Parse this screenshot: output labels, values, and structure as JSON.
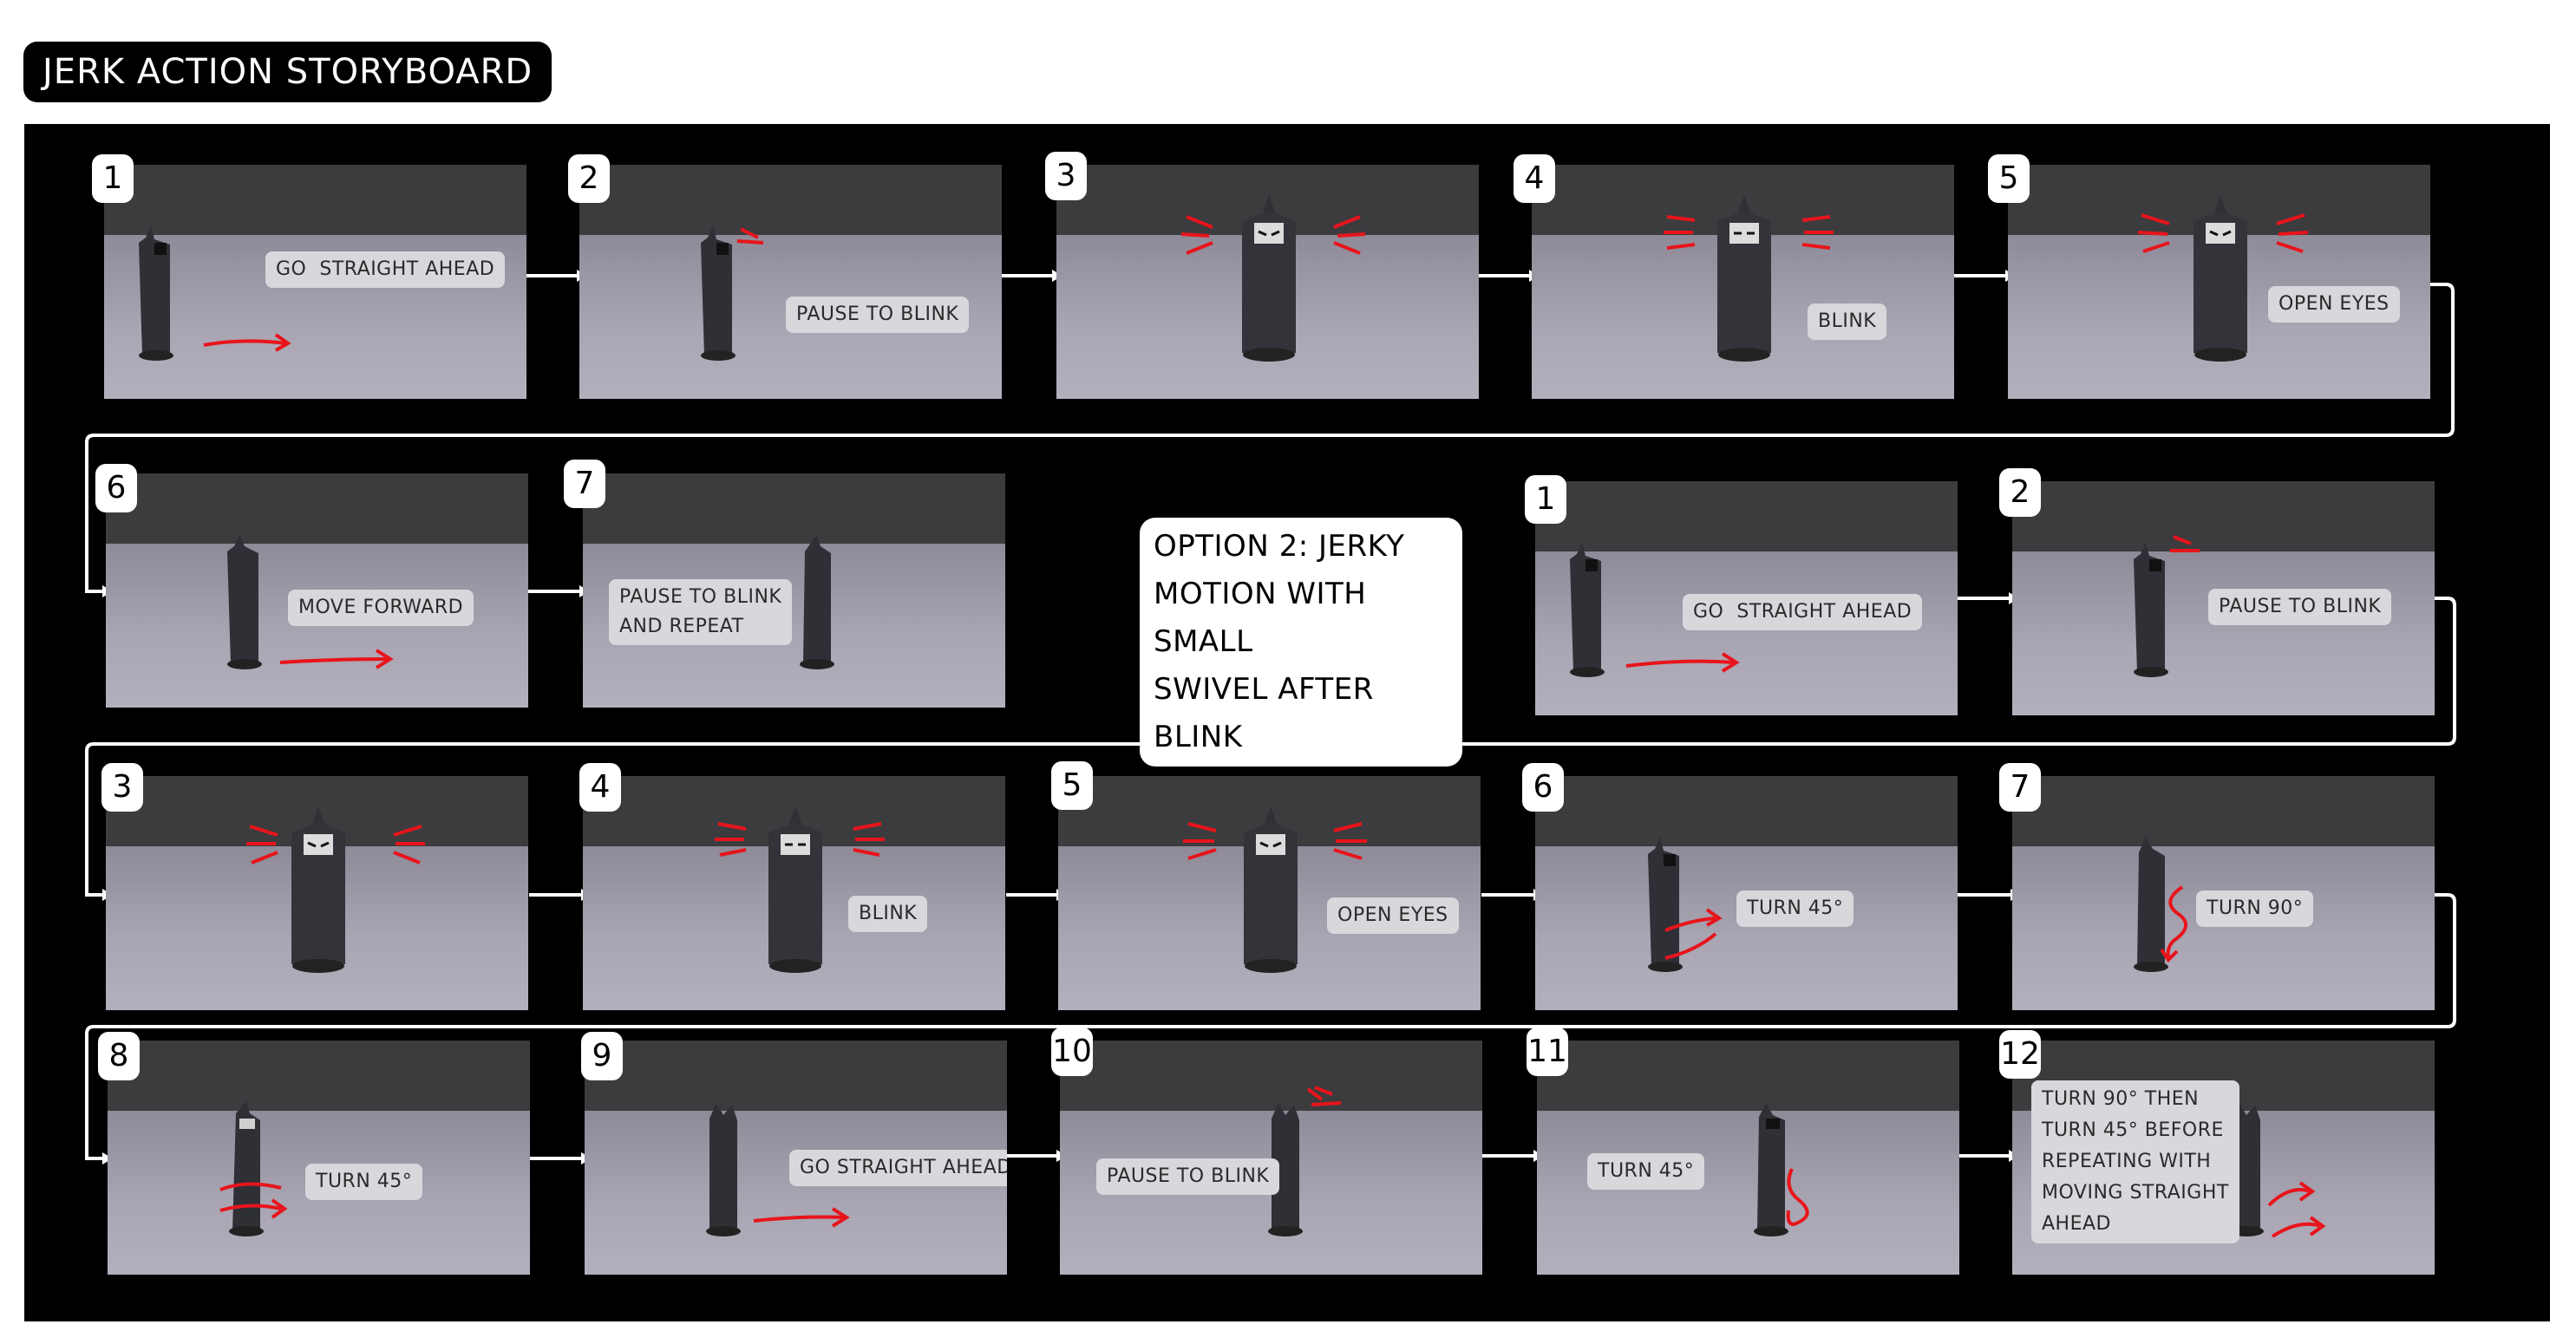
{
  "title": "JERK ACTION STORYBOARD",
  "option_label": "OPTION 2: JERKY MOTION WITH SMALL SWIVEL AFTER BLINK",
  "option_lines": [
    "OPTION 2: JERKY",
    "MOTION WITH SMALL",
    "SWIVEL AFTER BLINK"
  ],
  "colors": {
    "board": "#000000",
    "accent": "#e8141b",
    "caption_bg": "#d8d7dc",
    "floor": "#a29eac",
    "wall": "#3a3a3b"
  },
  "sequence_1": [
    {
      "number": "1",
      "caption": "GO  STRAIGHT AHEAD"
    },
    {
      "number": "2",
      "caption": "PAUSE TO BLINK"
    },
    {
      "number": "3",
      "caption": ""
    },
    {
      "number": "4",
      "caption": "BLINK"
    },
    {
      "number": "5",
      "caption": "OPEN EYES"
    },
    {
      "number": "6",
      "caption": "MOVE FORWARD"
    },
    {
      "number": "7",
      "caption": "PAUSE TO BLINK\nAND REPEAT"
    }
  ],
  "sequence_2": [
    {
      "number": "1",
      "caption": "GO  STRAIGHT AHEAD"
    },
    {
      "number": "2",
      "caption": "PAUSE TO BLINK"
    },
    {
      "number": "3",
      "caption": ""
    },
    {
      "number": "4",
      "caption": "BLINK"
    },
    {
      "number": "5",
      "caption": "OPEN EYES"
    },
    {
      "number": "6",
      "caption": "TURN 45°"
    },
    {
      "number": "7",
      "caption": "TURN 90°"
    },
    {
      "number": "8",
      "caption": "TURN 45°"
    },
    {
      "number": "9",
      "caption": "GO STRAIGHT AHEAD"
    },
    {
      "number": "10",
      "caption": "PAUSE TO BLINK"
    },
    {
      "number": "11",
      "caption": "TURN 45°"
    },
    {
      "number": "12",
      "caption": "TURN 90° THEN\nTURN 45° BEFORE\nREPEATING WITH\nMOVING STRAIGHT\nAHEAD"
    }
  ]
}
